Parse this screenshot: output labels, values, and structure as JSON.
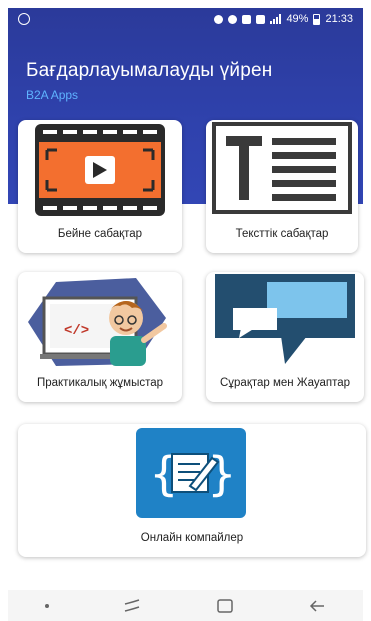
{
  "status_bar": {
    "time": "21:33",
    "battery": "49%"
  },
  "header": {
    "title": "Бағдарлауымалауды үйрен",
    "subtitle": "B2A Apps"
  },
  "cards": [
    {
      "label": "Бейне сабақтар",
      "icon": "video-play-icon"
    },
    {
      "label": "Тексттік сабақтар",
      "icon": "text-document-icon"
    },
    {
      "label": "Практикалық жұмыстар",
      "icon": "programmer-boy-icon"
    },
    {
      "label": "Сұрақтар мен Жауаптар",
      "icon": "chat-bubbles-icon"
    },
    {
      "label": "Онлайн компайлер",
      "icon": "code-editor-icon"
    }
  ],
  "colors": {
    "header": "#2f42ad",
    "subtitle": "#5fb3ff",
    "video_bg": "#f36f2f",
    "chat_dark": "#234e6f",
    "chat_light": "#7dc4ec",
    "compiler_bg": "#1f82c6"
  }
}
